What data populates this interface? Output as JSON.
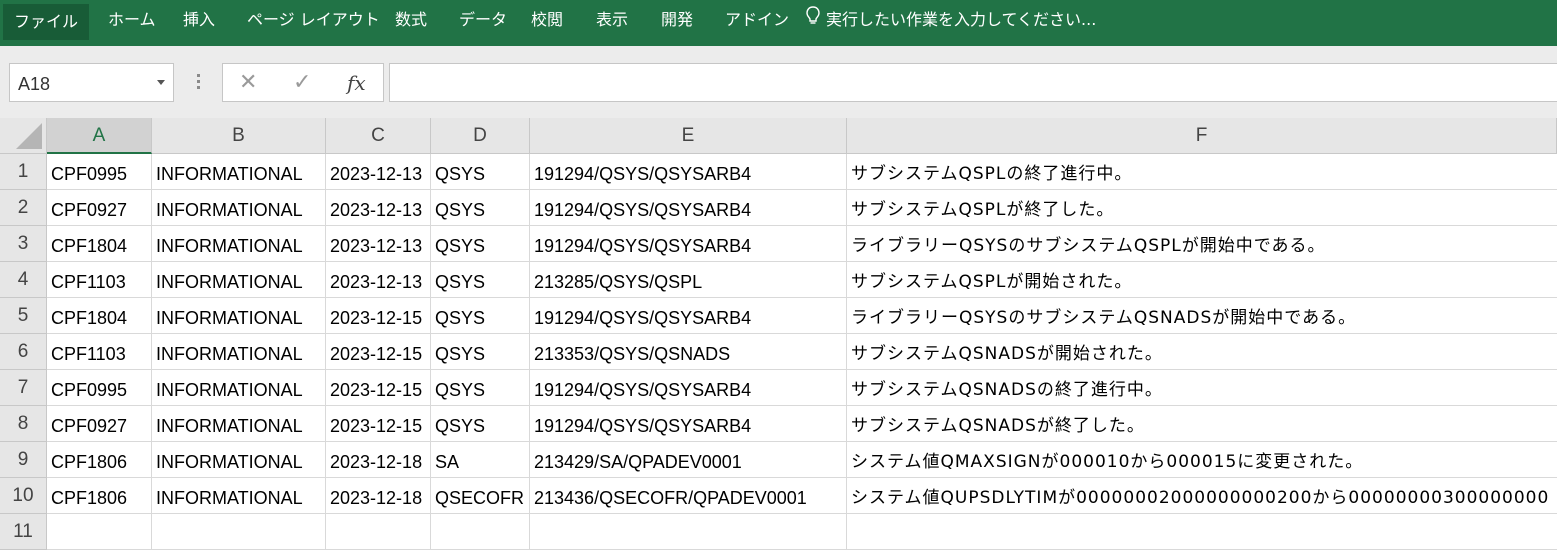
{
  "ribbon": {
    "tabs": [
      "ファイル",
      "ホーム",
      "挿入",
      "ページ レイアウト",
      "数式",
      "データ",
      "校閲",
      "表示",
      "開発",
      "アドイン"
    ],
    "tellme": "実行したい作業を入力してください..."
  },
  "formula_bar": {
    "name_box": "A18",
    "cancel": "✕",
    "enter": "✓",
    "fx": "fx",
    "content": ""
  },
  "grid": {
    "columns": [
      "A",
      "B",
      "C",
      "D",
      "E",
      "F"
    ],
    "selected_column": "A",
    "row_numbers": [
      "1",
      "2",
      "3",
      "4",
      "5",
      "6",
      "7",
      "8",
      "9",
      "10",
      "11"
    ],
    "rows": [
      [
        "CPF0995",
        "INFORMATIONAL",
        "2023-12-13",
        "QSYS",
        "191294/QSYS/QSYSARB4",
        "サブシステムQSPLの終了進行中。"
      ],
      [
        "CPF0927",
        "INFORMATIONAL",
        "2023-12-13",
        "QSYS",
        "191294/QSYS/QSYSARB4",
        "サブシステムQSPLが終了した。"
      ],
      [
        "CPF1804",
        "INFORMATIONAL",
        "2023-12-13",
        "QSYS",
        "191294/QSYS/QSYSARB4",
        "ライブラリーQSYSのサブシステムQSPLが開始中である。"
      ],
      [
        "CPF1103",
        "INFORMATIONAL",
        "2023-12-13",
        "QSYS",
        "213285/QSYS/QSPL",
        "サブシステムQSPLが開始された。"
      ],
      [
        "CPF1804",
        "INFORMATIONAL",
        "2023-12-15",
        "QSYS",
        "191294/QSYS/QSYSARB4",
        "ライブラリーQSYSのサブシステムQSNADSが開始中である。"
      ],
      [
        "CPF1103",
        "INFORMATIONAL",
        "2023-12-15",
        "QSYS",
        "213353/QSYS/QSNADS",
        "サブシステムQSNADSが開始された。"
      ],
      [
        "CPF0995",
        "INFORMATIONAL",
        "2023-12-15",
        "QSYS",
        "191294/QSYS/QSYSARB4",
        "サブシステムQSNADSの終了進行中。"
      ],
      [
        "CPF0927",
        "INFORMATIONAL",
        "2023-12-15",
        "QSYS",
        "191294/QSYS/QSYSARB4",
        "サブシステムQSNADSが終了した。"
      ],
      [
        "CPF1806",
        "INFORMATIONAL",
        "2023-12-18",
        "SA",
        "213429/SA/QPADEV0001",
        "システム値QMAXSIGNが000010から000015に変更された。"
      ],
      [
        "CPF1806",
        "INFORMATIONAL",
        "2023-12-18",
        "QSECOFR",
        "213436/QSECOFR/QPADEV0001",
        "システム値QUPSDLYTIMが00000002000000000200から00000000300000000"
      ],
      [
        "",
        "",
        "",
        "",
        "",
        ""
      ]
    ]
  }
}
